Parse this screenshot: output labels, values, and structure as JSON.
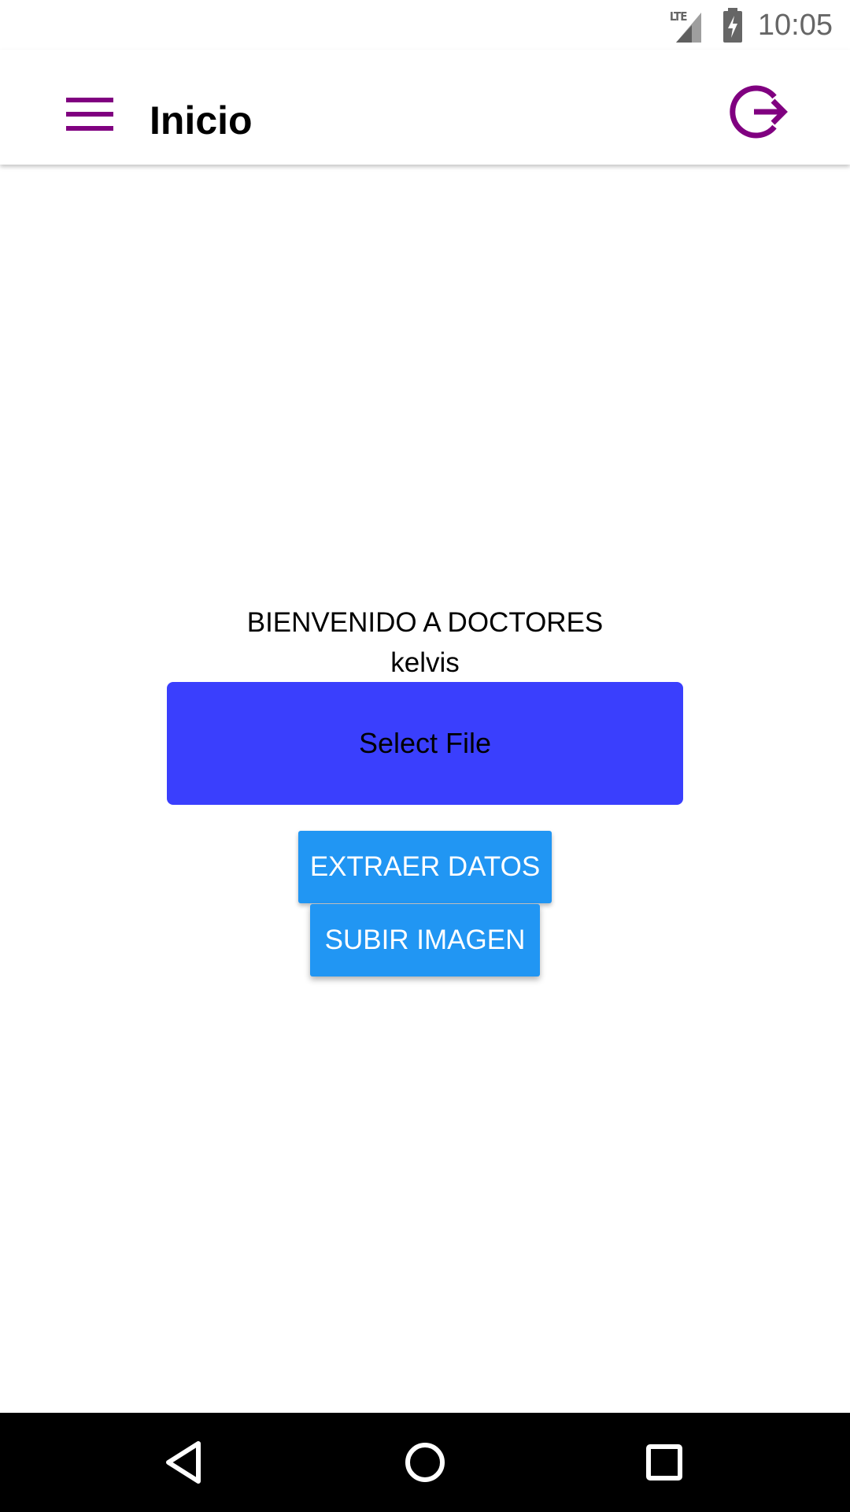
{
  "status_bar": {
    "network_label": "LTE",
    "time": "10:05",
    "icons": [
      "lte-signal-icon",
      "battery-charging-icon"
    ]
  },
  "app_bar": {
    "title": "Inicio",
    "menu_icon": "hamburger-menu-icon",
    "logout_icon": "logout-icon",
    "accent_color": "#800080"
  },
  "main": {
    "welcome_text": "BIENVENIDO A DOCTORES",
    "user_name": "kelvis",
    "select_file_label": "Select File",
    "select_file_color": "#3a3ffd",
    "extract_button_label": "EXTRAER DATOS",
    "upload_button_label": "SUBIR IMAGEN",
    "button_color": "#2196f3"
  },
  "nav_bar": {
    "icons": [
      "back-icon",
      "home-icon",
      "recents-icon"
    ]
  }
}
